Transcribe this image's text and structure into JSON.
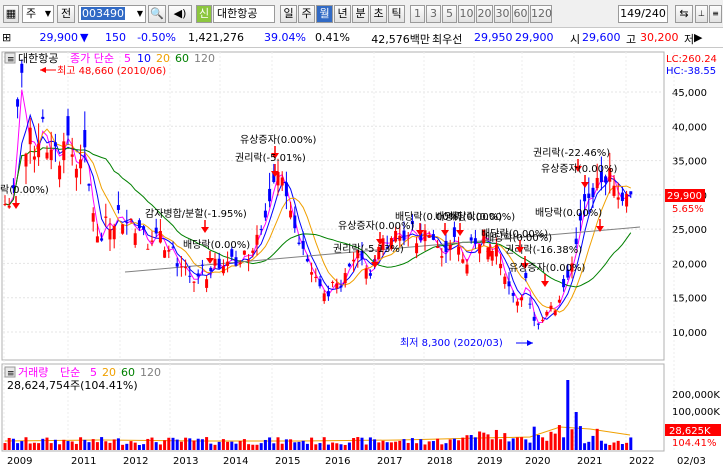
{
  "toolbar": {
    "market_label": "주",
    "period_prefix": "전",
    "code": "003490",
    "new_badge": "신",
    "name": "대한항공",
    "periods": [
      "일",
      "주",
      "월",
      "년",
      "분",
      "초",
      "틱"
    ],
    "active_period": "월",
    "intervals": [
      "1",
      "3",
      "5",
      "10",
      "20",
      "30",
      "60",
      "120"
    ],
    "count": "149/240"
  },
  "info": {
    "price": "29,900",
    "change": "150",
    "change_rate": "-0.50%",
    "volume": "1,421,276",
    "turnover_rate": "39.04%",
    "vol_ratio": "0.41%",
    "amount": "42,576백만",
    "best_ask_label": "최우선",
    "best_ask": "29,950",
    "best_bid": "29,900",
    "open_label": "시",
    "open": "29,600",
    "high_label": "고",
    "high": "30,200",
    "low_label": "저"
  },
  "price_panel": {
    "title": "대한항공",
    "ma_legend": "종가 단순",
    "ma_periods": [
      "5",
      "10",
      "20",
      "60",
      "120"
    ],
    "ma_colors": [
      "#ff00ff",
      "#0000ff",
      "#f0a000",
      "#008000",
      "#808080"
    ],
    "right_info_1": "LC:260.24",
    "right_info_2": "HC:-38.55",
    "high_annotation": "최고 48,660 (2010/06)",
    "low_annotation": "최저 8,300 (2020/03)",
    "current_price": "29,900",
    "current_pct": "5.65%",
    "y_ticks": [
      "45,000",
      "40,000",
      "35,000",
      "30,000",
      "25,000",
      "20,000",
      "15,000",
      "10,000"
    ],
    "events": [
      "락(0.00%)",
      "유상증자(0.00%)",
      "권리락(-5.01%)",
      "감자병합/분할(-1.95%)",
      "배당락(0.00%)",
      "유상증자(0.00%)",
      "권리락(-5.13%)",
      "배당락(0.00%)",
      "배당락(0.00%)",
      "배당락(0.00%)",
      "배당락(0.00%)",
      "권리락(-16.38%)",
      "유상증자(0.00%)",
      "배당락(0.00%)",
      "권리락(-22.46%)",
      "유상증자(0.00%)",
      "배당락(0.00%)"
    ]
  },
  "volume_panel": {
    "title": "거래량",
    "ma_legend": "단순",
    "ma_periods": [
      "5",
      "20",
      "60",
      "120"
    ],
    "value": "28,624,754주(104.41%)",
    "y_ticks": [
      "200,000K",
      "100,000K"
    ],
    "current": "28,625K",
    "current_pct": "104.41%"
  },
  "x_axis": [
    "2009",
    "2011",
    "2012",
    "2013",
    "2014",
    "2015",
    "2016",
    "2017",
    "2018",
    "2019",
    "2020",
    "2021",
    "2022",
    "02/03"
  ],
  "chart_data": {
    "type": "candlestick",
    "x": [
      "2009",
      "2010",
      "2011",
      "2012",
      "2013",
      "2014",
      "2015",
      "2016",
      "2017",
      "2018",
      "2019",
      "2020",
      "2021",
      "2022"
    ],
    "close_approx": [
      28000,
      45000,
      38000,
      26000,
      20000,
      21000,
      30000,
      18000,
      23000,
      21000,
      24000,
      15000,
      30000,
      29900
    ],
    "ylim": [
      8000,
      48000
    ],
    "high": {
      "value": 48660,
      "date": "2010/06"
    },
    "low": {
      "value": 8300,
      "date": "2020/03"
    },
    "last": 29900
  }
}
